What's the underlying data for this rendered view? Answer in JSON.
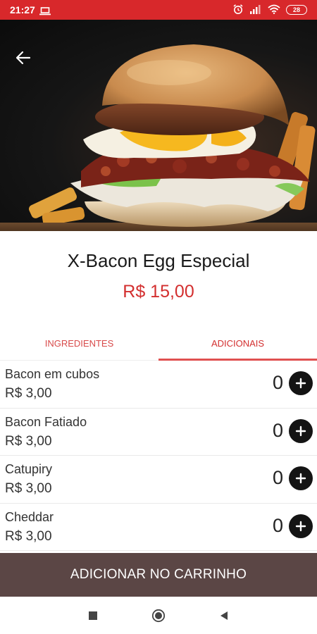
{
  "status_bar": {
    "time": "21:27",
    "battery": "28"
  },
  "product": {
    "title": "X-Bacon Egg Especial",
    "price": "R$ 15,00"
  },
  "tabs": [
    {
      "label": "INGREDIENTES",
      "active": false
    },
    {
      "label": "ADICIONAIS",
      "active": true
    }
  ],
  "addons": [
    {
      "name": "Bacon em cubos",
      "price": "R$ 3,00",
      "qty": "0"
    },
    {
      "name": "Bacon Fatiado",
      "price": "R$ 3,00",
      "qty": "0"
    },
    {
      "name": "Catupiry",
      "price": "R$ 3,00",
      "qty": "0"
    },
    {
      "name": "Cheddar",
      "price": "R$ 3,00",
      "qty": "0"
    }
  ],
  "cart_button": {
    "label": "ADICIONAR NO CARRINHO"
  },
  "colors": {
    "status_bar": "#d8282b",
    "price": "#d32f2f",
    "cart_button": "#5b4645"
  }
}
